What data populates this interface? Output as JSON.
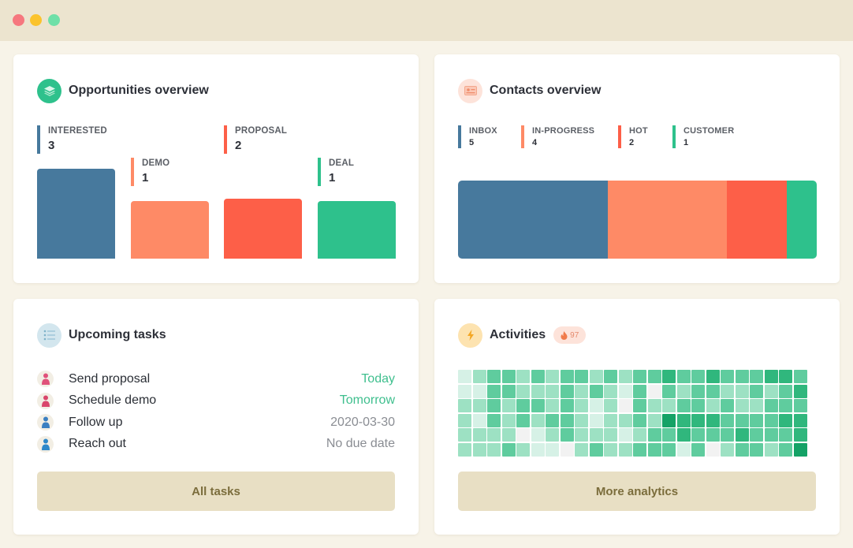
{
  "window": {
    "controls": [
      "close",
      "minimize",
      "maximize"
    ]
  },
  "opportunities": {
    "title": "Opportunities overview",
    "icon": "layers-icon",
    "stages": [
      {
        "label": "INTERESTED",
        "value": 3,
        "color": "#47799d"
      },
      {
        "label": "DEMO",
        "value": 1,
        "color": "#fe8a66"
      },
      {
        "label": "PROPOSAL",
        "value": 2,
        "color": "#fd5f48"
      },
      {
        "label": "DEAL",
        "value": 1,
        "color": "#2ec18c"
      }
    ]
  },
  "contacts": {
    "title": "Contacts overview",
    "icon": "contact-card-icon",
    "groups": [
      {
        "label": "INBOX",
        "value": 5,
        "color": "#47799d"
      },
      {
        "label": "IN-PROGRESS",
        "value": 4,
        "color": "#fe8a66"
      },
      {
        "label": "HOT",
        "value": 2,
        "color": "#fd5f48"
      },
      {
        "label": "CUSTOMER",
        "value": 1,
        "color": "#2ec18c"
      }
    ]
  },
  "tasks": {
    "title": "Upcoming tasks",
    "icon": "checklist-icon",
    "items": [
      {
        "label": "Send proposal",
        "due": "Today",
        "accent": true,
        "avatar_color": "#e0517a"
      },
      {
        "label": "Schedule demo",
        "due": "Tomorrow",
        "accent": true,
        "avatar_color": "#d9456b"
      },
      {
        "label": "Follow up",
        "due": "2020-03-30",
        "accent": false,
        "avatar_color": "#3a7fc1"
      },
      {
        "label": "Reach out",
        "due": "No due date",
        "accent": false,
        "avatar_color": "#2e88c9"
      }
    ],
    "button_label": "All tasks"
  },
  "activities": {
    "title": "Activities",
    "icon": "lightning-icon",
    "badge_icon": "fire-icon",
    "badge_value": "97",
    "button_label": "More analytics",
    "heatmap_colors": [
      "#f2f2f2",
      "#d6f1e6",
      "#9de1c3",
      "#5fcc9e",
      "#30b77d",
      "#14a266"
    ],
    "heatmap": [
      [
        1,
        2,
        3,
        3,
        2,
        3,
        2,
        3,
        3,
        2,
        3,
        2,
        3,
        3,
        4,
        3,
        3,
        4,
        3,
        3,
        3,
        4,
        4,
        3
      ],
      [
        1,
        1,
        3,
        3,
        2,
        2,
        2,
        3,
        2,
        3,
        2,
        1,
        3,
        0,
        3,
        2,
        3,
        3,
        2,
        2,
        3,
        2,
        3,
        4
      ],
      [
        2,
        2,
        3,
        2,
        3,
        3,
        2,
        3,
        2,
        1,
        2,
        0,
        3,
        2,
        2,
        3,
        3,
        2,
        3,
        2,
        2,
        3,
        3,
        3
      ],
      [
        2,
        1,
        3,
        2,
        3,
        2,
        3,
        3,
        2,
        1,
        2,
        2,
        3,
        2,
        5,
        4,
        4,
        4,
        3,
        3,
        3,
        3,
        4,
        4
      ],
      [
        2,
        2,
        2,
        2,
        0,
        1,
        2,
        3,
        2,
        2,
        2,
        1,
        2,
        3,
        3,
        4,
        3,
        3,
        3,
        4,
        3,
        3,
        3,
        4
      ],
      [
        2,
        2,
        2,
        3,
        2,
        1,
        1,
        0,
        2,
        3,
        2,
        2,
        3,
        3,
        3,
        1,
        3,
        0,
        2,
        3,
        3,
        2,
        3,
        5
      ]
    ]
  }
}
